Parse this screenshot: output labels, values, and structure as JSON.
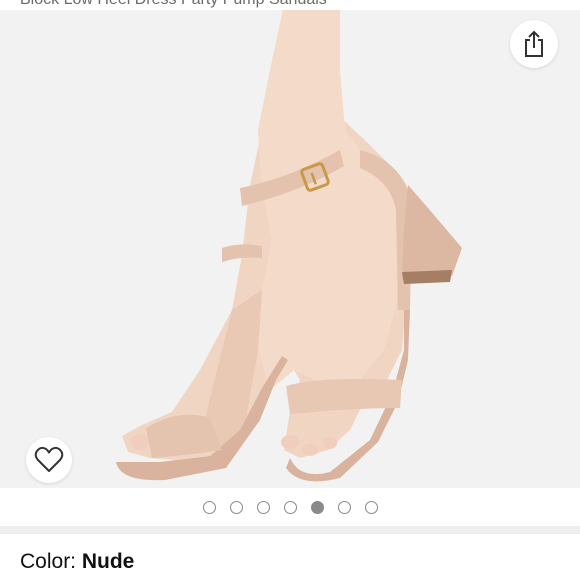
{
  "product": {
    "title_fragment": "Block Low Heel Dress Party Pump Sandals"
  },
  "image": {
    "alt": "Nude block heel ankle strap sandals",
    "background": "#f2f2f2",
    "shoe_color": "#e3c2ae"
  },
  "carousel": {
    "total": 7,
    "active_index": 4
  },
  "actions": {
    "share_icon": "share-icon",
    "wishlist_icon": "heart-outline-icon"
  },
  "variant": {
    "label": "Color:",
    "value": "Nude"
  }
}
